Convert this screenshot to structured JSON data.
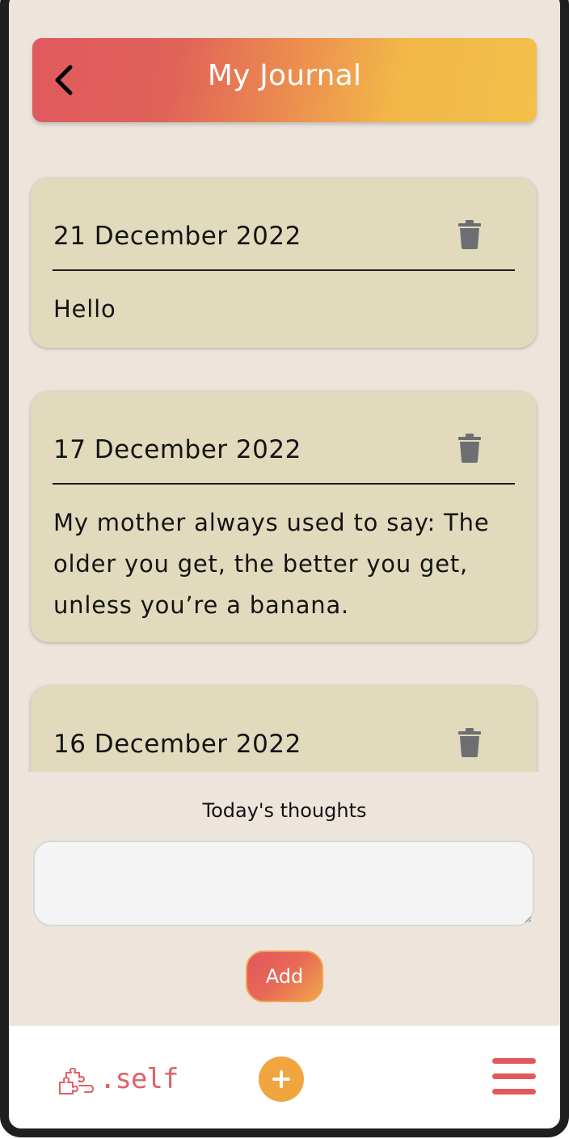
{
  "header": {
    "title": "My Journal",
    "back_icon": "chevron-left-icon"
  },
  "entries": [
    {
      "date": "21 December 2022",
      "text": "Hello"
    },
    {
      "date": "17 December 2022",
      "text": "My mother always used to say: The older you get, the better you get, unless you’re a banana."
    },
    {
      "date": "16 December 2022",
      "text": ""
    }
  ],
  "compose": {
    "label": "Today's thoughts",
    "value": "",
    "placeholder": "",
    "add_label": "Add"
  },
  "nav": {
    "logo_mark": ".self",
    "logo_icon": "puzzle-piece-icon",
    "plus_icon": "plus-icon",
    "menu_icon": "hamburger-menu-icon"
  },
  "colors": {
    "background": "#ede5dc",
    "card": "#e1dabd",
    "accent_red": "#e05a5c",
    "accent_orange": "#f0a53e"
  }
}
